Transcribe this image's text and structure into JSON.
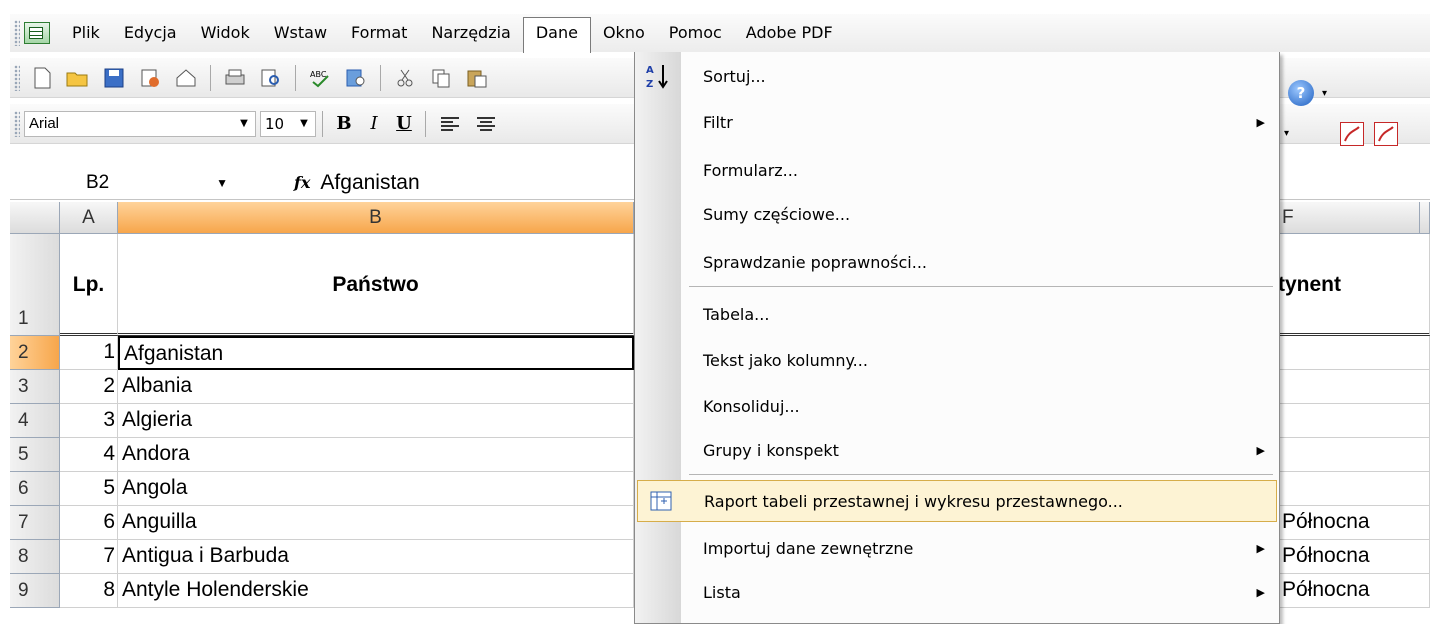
{
  "menubar": {
    "items": [
      {
        "label": "Plik"
      },
      {
        "label": "Edycja"
      },
      {
        "label": "Widok"
      },
      {
        "label": "Wstaw"
      },
      {
        "label": "Format"
      },
      {
        "label": "Narzędzia"
      },
      {
        "label": "Dane"
      },
      {
        "label": "Okno"
      },
      {
        "label": "Pomoc"
      },
      {
        "label": "Adobe PDF"
      }
    ],
    "active": "Dane"
  },
  "formatting": {
    "font": "Arial",
    "size": "10",
    "bold": "B",
    "italic": "I",
    "underline": "U"
  },
  "formula_bar": {
    "cell_ref": "B2",
    "fx": "fx",
    "value": "Afganistan"
  },
  "columns": [
    {
      "label": "A"
    },
    {
      "label": "B"
    },
    {
      "label": "F"
    }
  ],
  "header_row": {
    "row": "1",
    "a": "Lp.",
    "b": "Państwo",
    "f": "tynent"
  },
  "rows": [
    {
      "row": "2",
      "a": "1",
      "b": "Afganistan",
      "f": ""
    },
    {
      "row": "3",
      "a": "2",
      "b": "Albania",
      "f": ""
    },
    {
      "row": "4",
      "a": "3",
      "b": "Algieria",
      "f": ""
    },
    {
      "row": "5",
      "a": "4",
      "b": "Andora",
      "f": ""
    },
    {
      "row": "6",
      "a": "5",
      "b": "Angola",
      "f": ""
    },
    {
      "row": "7",
      "a": "6",
      "b": "Anguilla",
      "f": "Północna"
    },
    {
      "row": "8",
      "a": "7",
      "b": "Antigua i Barbuda",
      "f": "Północna"
    },
    {
      "row": "9",
      "a": "8",
      "b": "Antyle Holenderskie",
      "f": "Północna"
    }
  ],
  "dane_menu": {
    "items": [
      {
        "label": "Sortuj...",
        "icon": "sort-az-icon"
      },
      {
        "label": "Filtr",
        "submenu": true
      },
      {
        "label": "Formularz..."
      },
      {
        "label": "Sumy częściowe..."
      },
      {
        "label": "Sprawdzanie poprawności..."
      },
      {
        "label": "Tabela..."
      },
      {
        "label": "Tekst jako kolumny..."
      },
      {
        "label": "Konsoliduj..."
      },
      {
        "label": "Grupy i konspekt",
        "submenu": true
      },
      {
        "label": "Raport tabeli przestawnej i wykresu przestawnego...",
        "icon": "pivot-table-icon",
        "highlighted": true
      },
      {
        "label": "Importuj dane zewnętrzne",
        "submenu": true
      },
      {
        "label": "Lista",
        "submenu": true
      }
    ]
  }
}
